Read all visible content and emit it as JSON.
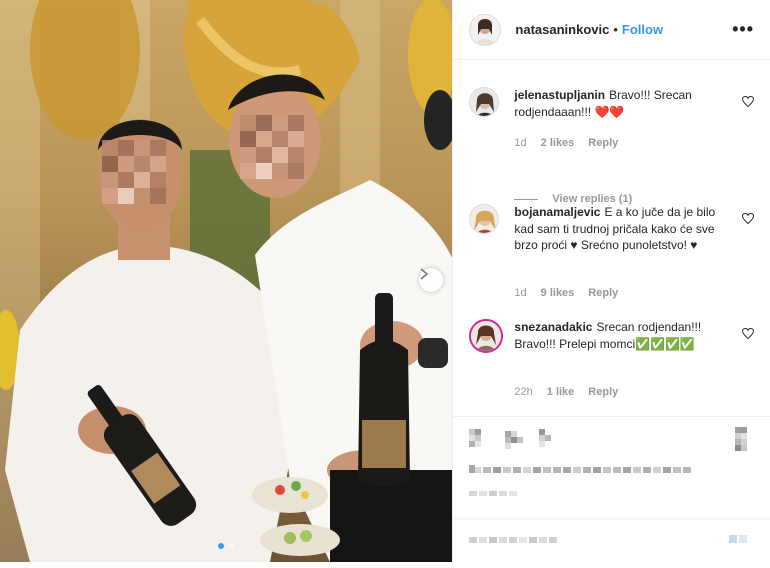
{
  "post": {
    "username": "natasaninkovic",
    "follow_label": "Follow",
    "separator": "•",
    "more_label": "•••"
  },
  "comments": [
    {
      "username": "jelenastupljanin",
      "text": "Bravo!!! Srecan rodjendaaan!!! ❤️❤️",
      "age": "1d",
      "likes": "2 likes",
      "reply": "Reply",
      "view_replies": "View replies (1)"
    },
    {
      "username": "bojanamaljevic",
      "text": "E a ko juče da je bilo kad sam ti trudnoj pričala kako će sve brzo proći ♥ Srećno punoletstvo! ♥",
      "age": "1d",
      "likes": "9 likes",
      "reply": "Reply"
    },
    {
      "username": "snezanadakic",
      "text": "Srecan rodjendan!!! Bravo!!! Prelepi momci✅✅✅✅",
      "age": "22h",
      "likes": "1 like",
      "reply": "Reply"
    }
  ],
  "carousel": {
    "count": 2,
    "active": 1
  },
  "colors": {
    "link": "#3897f0",
    "heart": "#ed4956",
    "check": "#3cb043"
  }
}
